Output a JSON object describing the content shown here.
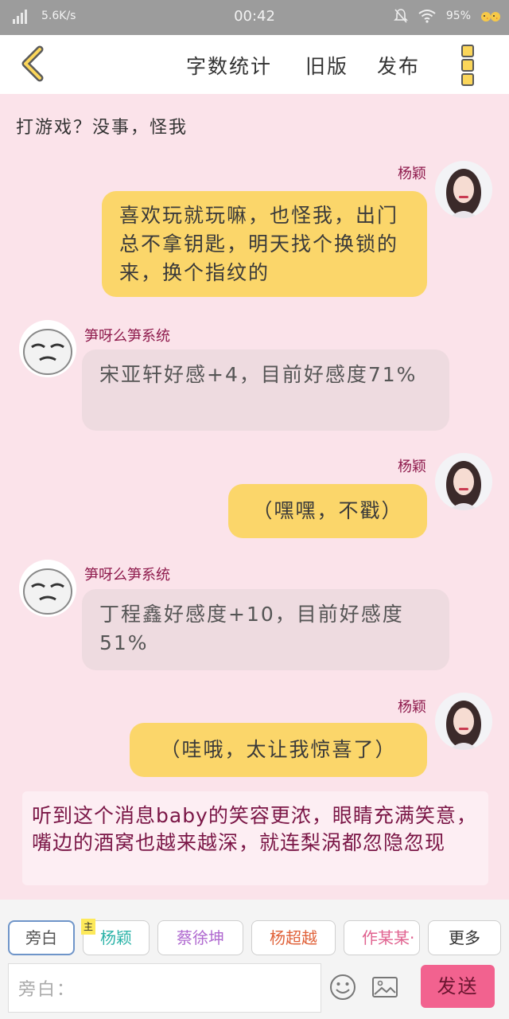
{
  "status_bar": {
    "network_speed": "5.6K/s",
    "time": "00:42",
    "battery": "95%"
  },
  "toolbar": {
    "word_count_label": "字数统计",
    "old_version_label": "旧版",
    "publish_label": "发布"
  },
  "chat": {
    "top_narration": "打游戏？没事，怪我",
    "messages": [
      {
        "speaker": "杨颖",
        "text": "喜欢玩就玩嘛，也怪我，出门总不拿钥匙，明天找个换锁的来，换个指纹的",
        "side": "right"
      },
      {
        "speaker": "笋呀么笋系统",
        "text": "宋亚轩好感+4，目前好感度71%",
        "side": "left"
      },
      {
        "speaker": "杨颖",
        "text": "（嘿嘿，不戳）",
        "side": "right"
      },
      {
        "speaker": "笋呀么笋系统",
        "text": "丁程鑫好感度+10，目前好感度51%",
        "side": "left"
      },
      {
        "speaker": "杨颖",
        "text": "（哇哦，太让我惊喜了）",
        "side": "right"
      }
    ],
    "narration": "听到这个消息baby的笑容更浓，眼睛充满笑意，嘴边的酒窝也越来越深，就连梨涡都忽隐忽现"
  },
  "role_bar": {
    "roles": [
      {
        "label": "旁白",
        "color": "#555555"
      },
      {
        "label": "杨颖",
        "color": "#2bb3a8"
      },
      {
        "label": "蔡徐坤",
        "color": "#b06ad0"
      },
      {
        "label": "杨超越",
        "color": "#e0623a"
      },
      {
        "label": "作某某·",
        "color": "#e0628f"
      }
    ],
    "main_badge": "主",
    "more_label": "更多"
  },
  "composer": {
    "input_placeholder": "旁白：",
    "send_label": "发送"
  },
  "colors": {
    "accent_pink": "#f2628f",
    "bubble_yellow": "#fbd66a",
    "background": "#fbe3ea",
    "speaker_name": "#8e1a4c"
  }
}
